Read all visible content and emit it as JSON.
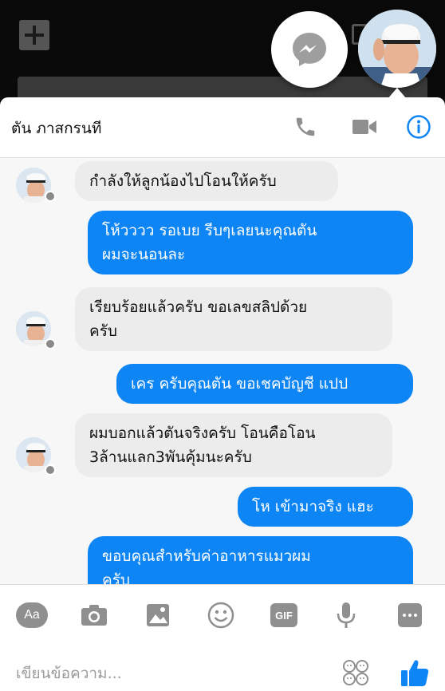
{
  "chat": {
    "contact_name": "ตัน ภาสกรนที",
    "messages": [
      {
        "direction": "in",
        "text_lines": [
          "กำลังให้ลูกน้องไปโอนให้ครับ"
        ]
      },
      {
        "direction": "out",
        "text_lines": [
          "โห้วววว รอเบย รีบๆเลยนะคุณตัน",
          "ผมจะนอนละ"
        ]
      },
      {
        "direction": "in",
        "text_lines": [
          "เรียบร้อยแล้วครับ ขอเลขสลิปด้วย",
          "ครับ"
        ]
      },
      {
        "direction": "out",
        "text_lines": [
          "เคร ครับคุณตัน ขอเชคบัญชี แปป"
        ]
      },
      {
        "direction": "in",
        "text_lines": [
          "ผมบอกแล้วตันจริงครับ โอนคือโอน",
          "3ล้านแลก3พันคุ้มนะครับ"
        ]
      },
      {
        "direction": "out",
        "text_lines": [
          "โห เข้ามาจริง แฮะ"
        ]
      },
      {
        "direction": "out",
        "text_lines": [
          "ขอบคุณสำหรับค่าอาหารแมวผม",
          "ครับ"
        ]
      }
    ]
  },
  "composer": {
    "aa_label": "Aa",
    "gif_label": "GIF",
    "placeholder": "เขียนข้อความ..."
  },
  "icons": {
    "header": [
      "phone-icon",
      "video-camera-icon",
      "info-icon"
    ],
    "composer": [
      "camera-icon",
      "image-icon",
      "emoji-icon",
      "microphone-icon",
      "more-icon",
      "stickers-icon",
      "like-icon"
    ]
  },
  "colors": {
    "accent": "#0e85f5",
    "incoming_bubble": "#ececec",
    "icon_gray": "#8f8f8f"
  }
}
